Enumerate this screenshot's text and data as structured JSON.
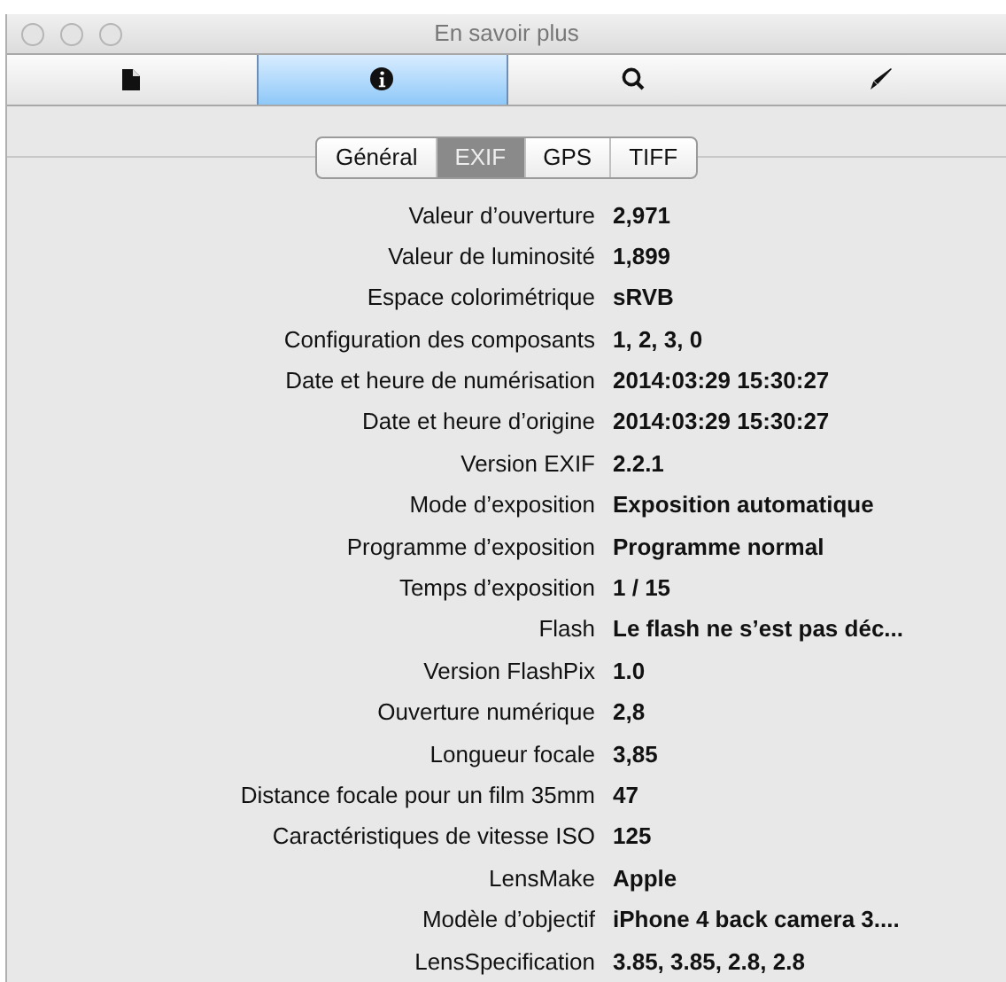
{
  "window": {
    "title": "En savoir plus"
  },
  "toolbar": [
    {
      "selected": false
    },
    {
      "selected": true
    },
    {
      "selected": false
    },
    {
      "selected": false
    }
  ],
  "tabs": [
    {
      "label": "Général",
      "selected": false
    },
    {
      "label": "EXIF",
      "selected": true
    },
    {
      "label": "GPS",
      "selected": false
    },
    {
      "label": "TIFF",
      "selected": false
    }
  ],
  "rows": [
    {
      "label": "Valeur d’ouverture",
      "value": "2,971"
    },
    {
      "label": "Valeur de luminosité",
      "value": "1,899"
    },
    {
      "label": "Espace colorimétrique",
      "value": "sRVB"
    },
    {
      "label": "Configuration des composants",
      "value": "1, 2, 3, 0"
    },
    {
      "label": "Date et heure de numérisation",
      "value": "2014:03:29 15:30:27"
    },
    {
      "label": "Date et heure d’origine",
      "value": "2014:03:29 15:30:27"
    },
    {
      "label": "Version EXIF",
      "value": "2.2.1"
    },
    {
      "label": "Mode d’exposition",
      "value": "Exposition automatique"
    },
    {
      "label": "Programme d’exposition",
      "value": "Programme normal"
    },
    {
      "label": "Temps d’exposition",
      "value": "1 / 15"
    },
    {
      "label": "Flash",
      "value": "Le flash ne s’est pas déc..."
    },
    {
      "label": "Version FlashPix",
      "value": "1.0"
    },
    {
      "label": "Ouverture numérique",
      "value": "2,8"
    },
    {
      "label": "Longueur focale",
      "value": "3,85"
    },
    {
      "label": "Distance focale pour un film 35mm",
      "value": "47"
    },
    {
      "label": "Caractéristiques de vitesse ISO",
      "value": "125"
    },
    {
      "label": "LensMake",
      "value": "Apple"
    },
    {
      "label": "Modèle d’objectif",
      "value": "iPhone 4 back camera 3...."
    },
    {
      "label": "LensSpecification",
      "value": "3.85, 3.85, 2.8, 2.8"
    }
  ]
}
